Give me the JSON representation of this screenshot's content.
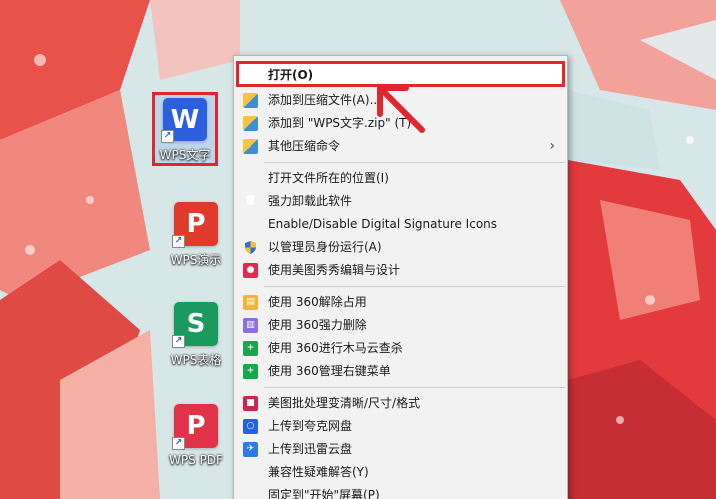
{
  "desktop": {
    "icons": [
      {
        "id": "wps-writer",
        "glyph": "W",
        "label": "WPS文字",
        "color": "#2b5fe0"
      },
      {
        "id": "wps-present",
        "glyph": "P",
        "label": "WPS演示",
        "color": "#e03a2a"
      },
      {
        "id": "wps-sheets",
        "glyph": "S",
        "label": "WPS表格",
        "color": "#1a9a5e"
      },
      {
        "id": "wps-pdf",
        "glyph": "P",
        "label": "WPS PDF",
        "color": "#e23248"
      }
    ]
  },
  "context_menu": {
    "open": "打开(O)",
    "add_archive": "添加到压缩文件(A)...",
    "add_zip": "添加到 \"WPS文字.zip\" (T)",
    "other_compress": "其他压缩命令",
    "open_location": "打开文件所在的位置(I)",
    "force_uninstall": "强力卸载此软件",
    "digital_signature": "Enable/Disable Digital Signature Icons",
    "run_as_admin": "以管理员身份运行(A)",
    "meitu_edit": "使用美图秀秀编辑与设计",
    "unlock_360": "使用 360解除占用",
    "force_delete_360": "使用 360强力删除",
    "trojan_scan_360": "使用 360进行木马云查杀",
    "manage_menu_360": "使用 360管理右键菜单",
    "meitu_batch": "美图批处理变清晰/尺寸/格式",
    "upload_quark": "上传到夸克网盘",
    "upload_xunlei": "上传到迅雷云盘",
    "compat_troubleshoot": "兼容性疑难解答(Y)",
    "pin_start": "固定到\"开始\"屏幕(P)"
  },
  "colors": {
    "highlight_border": "#e0262e",
    "menu_bg": "#f2f2f2"
  }
}
